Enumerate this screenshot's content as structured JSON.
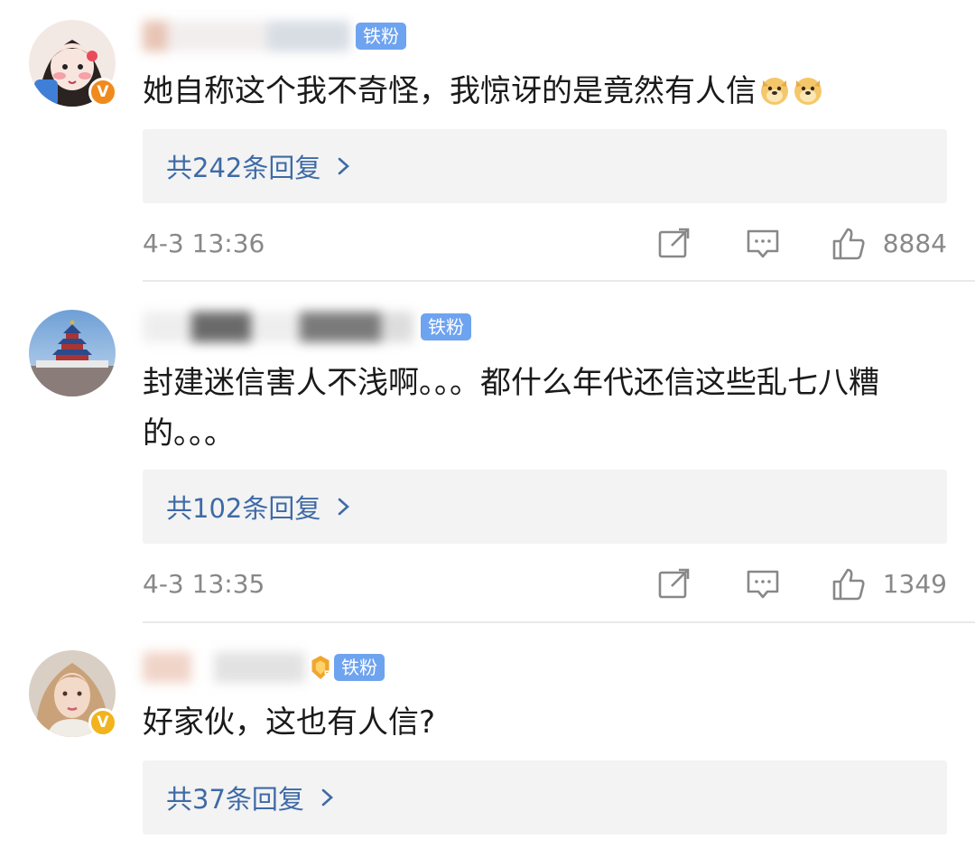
{
  "colors": {
    "link_blue": "#3e6aa6",
    "fan_badge": "#6ea3f0",
    "verified_orange": "#f08a1c",
    "verified_gold": "#f2b31c",
    "meta_gray": "#888888",
    "reply_bg": "#f3f3f3"
  },
  "comments": [
    {
      "fan_badge": "铁粉",
      "text": "她自称这个我不奇怪，我惊讶的是竟然有人信",
      "emojis": [
        "doge-emoji",
        "doge-emoji"
      ],
      "verified_badge": "V",
      "replies_label": "共242条回复",
      "time": "4-3 13:36",
      "likes": "8884"
    },
    {
      "fan_badge": "铁粉",
      "text": "封建迷信害人不浅啊。。。都什么年代还信这些乱七八糟的。。。",
      "emojis": [],
      "verified_badge": "",
      "replies_label": "共102条回复",
      "time": "4-3 13:35",
      "likes": "1349"
    },
    {
      "fan_badge": "铁粉",
      "text": "好家伙，这也有人信?",
      "emojis": [],
      "verified_badge": "V",
      "level_badge": "5",
      "replies_label": "共37条回复"
    }
  ],
  "icons": {
    "share": "share-icon",
    "comment": "comment-icon",
    "like": "thumbs-up-icon",
    "chevron": "chevron-right-icon"
  }
}
